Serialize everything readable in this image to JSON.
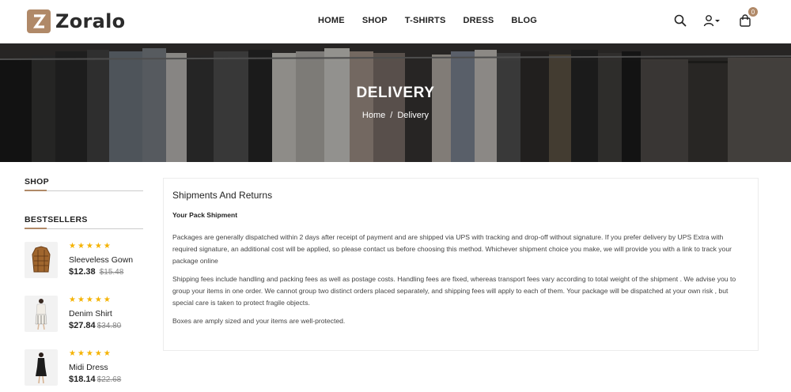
{
  "brand": {
    "name": "Zoralo",
    "logo_letter": "Z",
    "accent": "#b08968"
  },
  "nav": {
    "items": [
      {
        "label": "HOME"
      },
      {
        "label": "SHOP"
      },
      {
        "label": "T-SHIRTS"
      },
      {
        "label": "DRESS"
      },
      {
        "label": "BLOG"
      }
    ]
  },
  "header_icons": {
    "search": "search-icon",
    "account": "user-icon",
    "cart": "bag-icon",
    "cart_count": "0"
  },
  "hero": {
    "title": "DELIVERY",
    "breadcrumb": {
      "home": "Home",
      "separator": "/",
      "current": "Delivery"
    }
  },
  "sidebar": {
    "shop_heading": "SHOP",
    "bestsellers_heading": "BESTSELLERS",
    "products": [
      {
        "name": "Sleeveless Gown",
        "price": "$12.38",
        "old_price": "$15.48",
        "stars": "★★★★★",
        "rating": 5
      },
      {
        "name": "Denim Shirt",
        "price": "$27.84",
        "old_price": "$34.80",
        "stars": "★★★★★",
        "rating": 5
      },
      {
        "name": "Midi Dress",
        "price": "$18.14",
        "old_price": "$22.68",
        "stars": "★★★★★",
        "rating": 5
      }
    ]
  },
  "content": {
    "title": "Shipments And Returns",
    "subtitle": "Your Pack Shipment",
    "paragraphs": [
      "Packages are generally dispatched within 2 days after receipt of payment and are shipped via UPS with tracking and drop-off without signature. If you prefer delivery by UPS Extra with required signature, an additional cost will be applied, so please contact us before choosing this method. Whichever shipment choice you make, we will provide you with a link to track your package online",
      "Shipping fees include handling and packing fees as well as postage costs. Handling fees are fixed, whereas transport fees vary according to total weight of the shipment . We advise you to group your items in one order. We cannot group two distinct orders placed separately, and shipping fees will apply to each of them. Your package will be dispatched at your own risk , but special care is taken to protect fragile objects.",
      "Boxes are amply sized and your items are well-protected."
    ]
  }
}
